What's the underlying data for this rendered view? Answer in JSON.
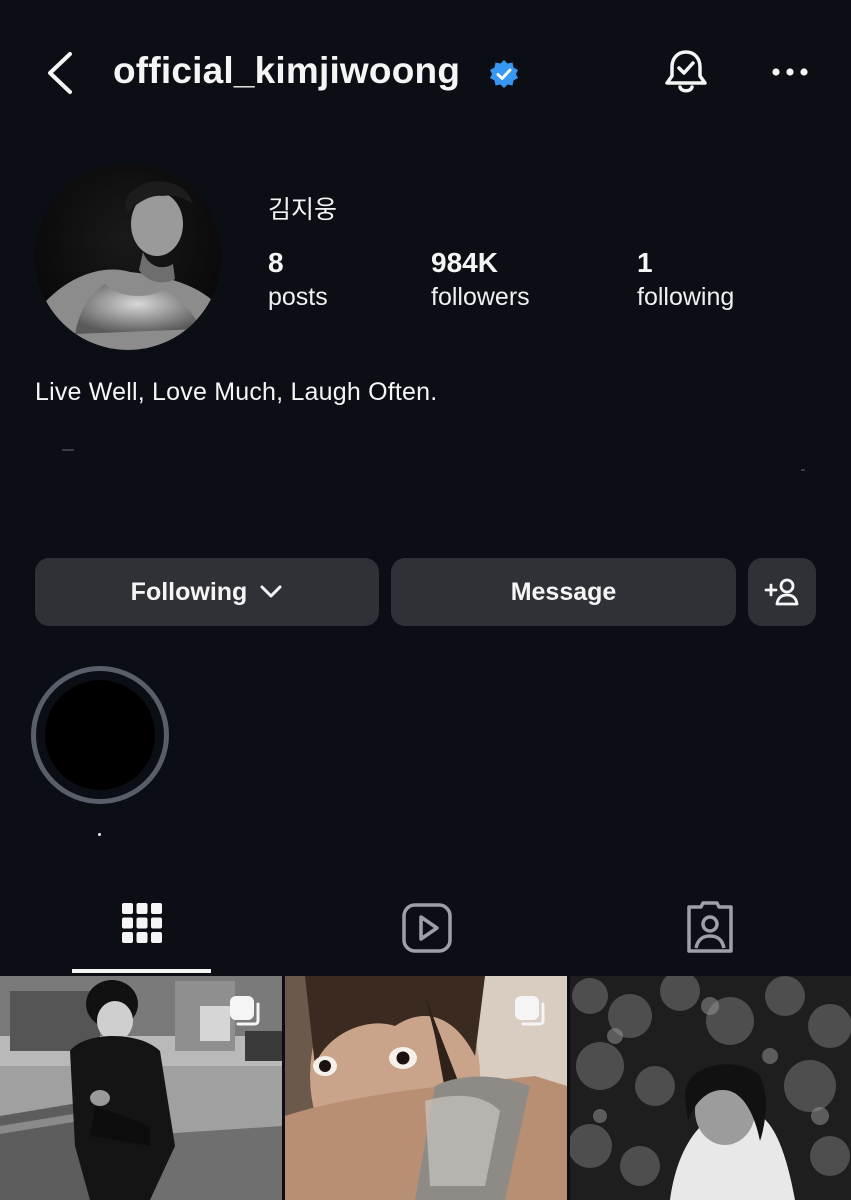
{
  "header": {
    "username": "official_kimjiwoong",
    "back_icon": "chevron-left-icon",
    "verified_icon": "verified-badge-icon",
    "notification_icon": "bell-check-icon",
    "more_icon": "ellipsis-icon"
  },
  "profile": {
    "display_name": "김지웅",
    "stats": [
      {
        "value": "8",
        "label": "posts"
      },
      {
        "value": "984K",
        "label": "followers"
      },
      {
        "value": "1",
        "label": "following"
      }
    ],
    "bio": "Live Well, Love Much, Laugh Often."
  },
  "actions": {
    "following_label": "Following",
    "message_label": "Message",
    "add_user_icon": "person-add-icon"
  },
  "tabs": [
    {
      "name": "posts",
      "icon": "grid-icon",
      "selected": true
    },
    {
      "name": "reels",
      "icon": "reels-icon",
      "selected": false
    },
    {
      "name": "tagged",
      "icon": "tagged-icon",
      "selected": false
    }
  ],
  "colors": {
    "background": "#0b0e14",
    "button": "#2f3136",
    "verified": "#3897f0",
    "text": "#f5f5f5"
  }
}
